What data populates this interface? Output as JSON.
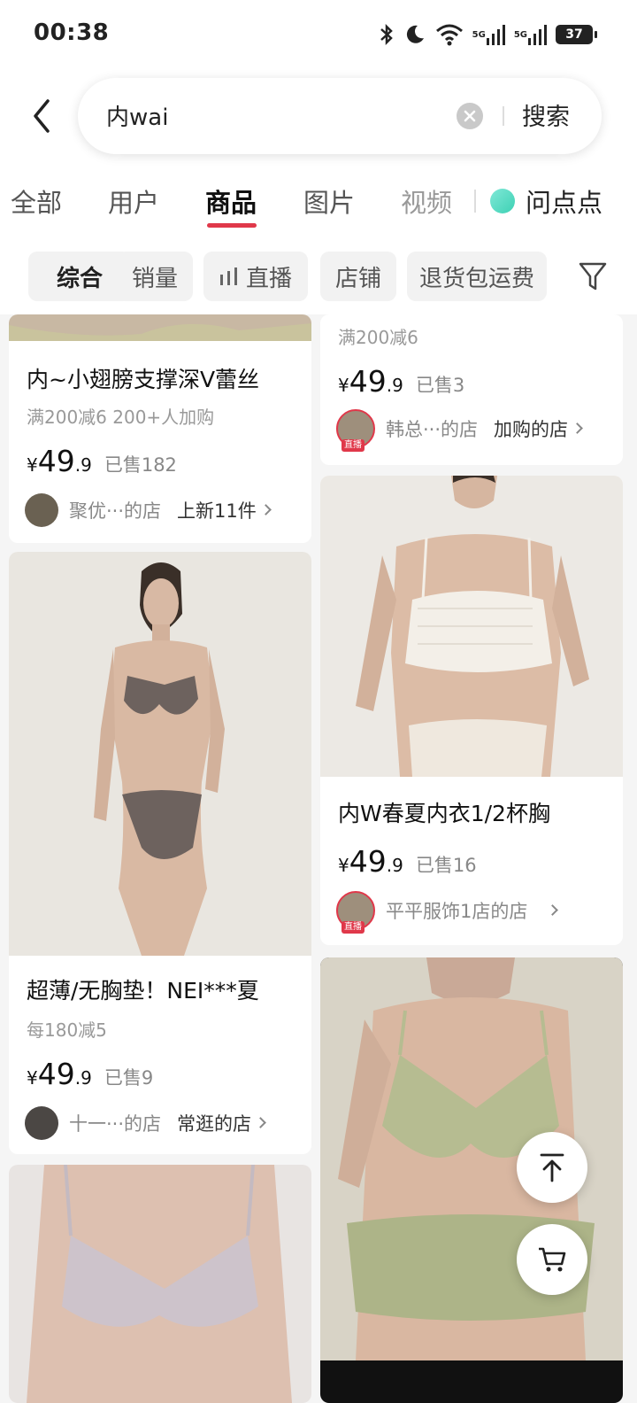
{
  "status_bar": {
    "time": "00:38",
    "battery": "37",
    "net1": "5G",
    "net2": "5G"
  },
  "search": {
    "query": "内wai",
    "button": "搜索"
  },
  "tabs": [
    "全部",
    "用户",
    "商品",
    "图片",
    "视频",
    "问点点"
  ],
  "filters": [
    "综合",
    "销量",
    "直播",
    "店铺",
    "退货包运费"
  ],
  "products": [
    {
      "title": "内~小翅膀支撑深V蕾丝",
      "promo": "满200减6   200+人加购",
      "price_symbol": "¥",
      "price_int": "49",
      "price_dec": ".9",
      "sold": "已售182",
      "shop": "聚优···的店",
      "shop_tag": "上新11件"
    },
    {
      "promo": "满200减6",
      "price_symbol": "¥",
      "price_int": "49",
      "price_dec": ".9",
      "sold": "已售3",
      "shop": "韩总···的店",
      "shop_tag": "加购的店",
      "live": "直播"
    },
    {
      "title": "内W春夏内衣1/2杯胸",
      "price_symbol": "¥",
      "price_int": "49",
      "price_dec": ".9",
      "sold": "已售16",
      "shop": "平平服饰1店的店",
      "live": "直播"
    },
    {
      "title": "超薄/无胸垫！NEI***夏",
      "promo": "每180减5",
      "price_symbol": "¥",
      "price_int": "49",
      "price_dec": ".9",
      "sold": "已售9",
      "shop": "十一···的店",
      "shop_tag": "常逛的店"
    }
  ],
  "colors": {
    "accent": "#e0384a",
    "teal": "#3ed1b4"
  }
}
